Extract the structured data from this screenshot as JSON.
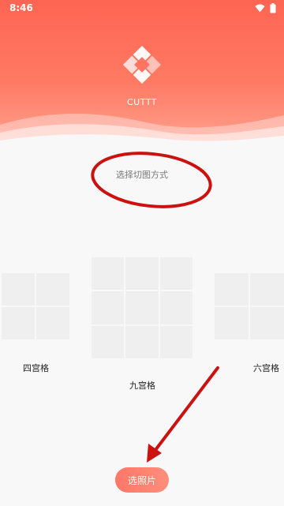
{
  "status_bar": {
    "time": "8:46",
    "icons": [
      "wifi-icon",
      "battery-icon"
    ]
  },
  "header": {
    "app_name": "CUTTT",
    "logo_icon": "cube-logo-icon"
  },
  "main": {
    "prompt": "选择切图方式",
    "options": [
      {
        "label": "四宫格",
        "rows": 2,
        "cols": 2
      },
      {
        "label": "九宫格",
        "rows": 3,
        "cols": 3
      },
      {
        "label": "六宫格",
        "rows": 2,
        "cols": 2
      }
    ],
    "pick_button_label": "选照片"
  },
  "colors": {
    "accent": "#fe6553",
    "accent_light": "#ffa493",
    "annotation_red": "#cc1111",
    "grid_cell": "#efefef",
    "background": "#f8f8f8"
  }
}
